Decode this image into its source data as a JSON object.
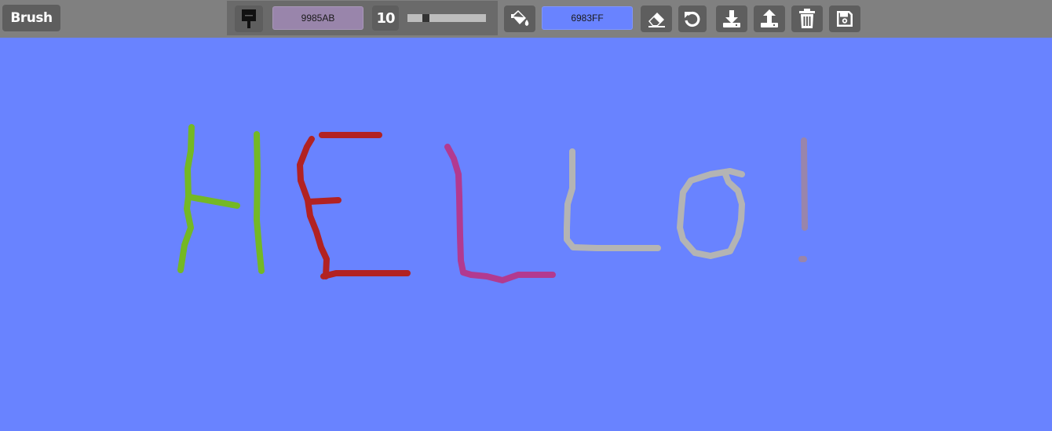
{
  "toolbar": {
    "mode_label": "Brush",
    "brush_color_hex": "9985AB",
    "brush_size": "10",
    "brush_size_slider_fraction": 0.21,
    "fill_color_hex": "6983FF",
    "tools": [
      "eraser-icon",
      "undo-icon",
      "download-icon",
      "upload-icon",
      "trash-icon",
      "save-icon"
    ]
  },
  "colors": {
    "toolbar_bg": "#808080",
    "canvas_bg": "#6983FF",
    "brush_swatch": "#9985AB",
    "fill_swatch": "#6983FF"
  }
}
